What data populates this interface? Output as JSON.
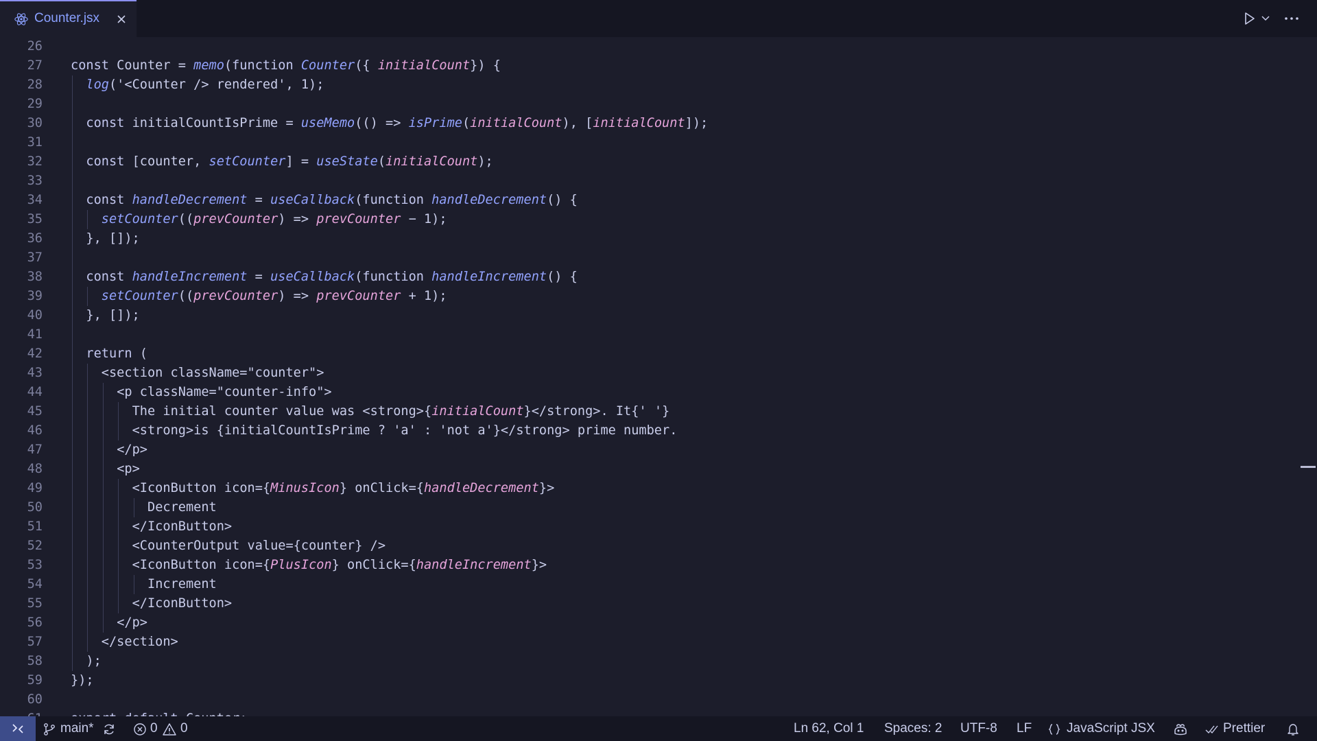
{
  "tab": {
    "label": "Counter.jsx",
    "icon": "react-icon"
  },
  "toolbar": {
    "run_icon": "play-icon",
    "run_menu_icon": "chevron-down-icon",
    "more_icon": "ellipsis-icon"
  },
  "editor": {
    "lines": [
      {
        "num": "26",
        "indent": 0,
        "guides": 0,
        "tokens": []
      },
      {
        "num": "27",
        "indent": 0,
        "guides": 0,
        "tokens": [
          [
            "kw",
            "const "
          ],
          [
            "",
            "Counter = "
          ],
          [
            "fn",
            "memo"
          ],
          [
            "",
            "("
          ],
          [
            "kw",
            "function "
          ],
          [
            "fn",
            "Counter"
          ],
          [
            "",
            "({ "
          ],
          [
            "prm",
            "initialCount"
          ],
          [
            "",
            ""
          ],
          [
            "",
            ""
          ],
          [
            "",
            "}) {"
          ]
        ]
      },
      {
        "num": "28",
        "indent": 1,
        "guides": 1,
        "tokens": [
          [
            "fn",
            "log"
          ],
          [
            "",
            "('<Counter /> rendered', 1);"
          ]
        ]
      },
      {
        "num": "29",
        "indent": 0,
        "guides": 1,
        "tokens": []
      },
      {
        "num": "30",
        "indent": 1,
        "guides": 1,
        "tokens": [
          [
            "kw",
            "const "
          ],
          [
            "",
            "initialCountIsPrime = "
          ],
          [
            "fn",
            "useMemo"
          ],
          [
            "",
            "(() => "
          ],
          [
            "fn",
            "isPrime"
          ],
          [
            "",
            "("
          ],
          [
            "prm",
            "initialCount"
          ],
          [
            "",
            "), ["
          ],
          [
            "prm",
            "initialCount"
          ],
          [
            "",
            "]);"
          ]
        ]
      },
      {
        "num": "31",
        "indent": 0,
        "guides": 1,
        "tokens": []
      },
      {
        "num": "32",
        "indent": 1,
        "guides": 1,
        "tokens": [
          [
            "kw",
            "const "
          ],
          [
            "",
            "[counter, "
          ],
          [
            "fn",
            "setCounter"
          ],
          [
            "",
            "] = "
          ],
          [
            "fn",
            "useState"
          ],
          [
            "",
            "("
          ],
          [
            "prm",
            "initialCount"
          ],
          [
            "",
            ");"
          ]
        ]
      },
      {
        "num": "33",
        "indent": 0,
        "guides": 1,
        "tokens": []
      },
      {
        "num": "34",
        "indent": 1,
        "guides": 1,
        "tokens": [
          [
            "kw",
            "const "
          ],
          [
            "fn",
            "handleDecrement"
          ],
          [
            "",
            " = "
          ],
          [
            "fn",
            "useCallback"
          ],
          [
            "",
            "("
          ],
          [
            "kw",
            "function "
          ],
          [
            "fn",
            "handleDecrement"
          ],
          [
            "",
            "() {"
          ]
        ]
      },
      {
        "num": "35",
        "indent": 2,
        "guides": 2,
        "tokens": [
          [
            "fn",
            "setCounter"
          ],
          [
            "",
            "(("
          ],
          [
            "prm",
            "prevCounter"
          ],
          [
            "",
            ") => "
          ],
          [
            "prm",
            "prevCounter"
          ],
          [
            "",
            " − 1);"
          ]
        ]
      },
      {
        "num": "36",
        "indent": 1,
        "guides": 1,
        "tokens": [
          [
            "",
            "}, []);"
          ]
        ]
      },
      {
        "num": "37",
        "indent": 0,
        "guides": 1,
        "tokens": []
      },
      {
        "num": "38",
        "indent": 1,
        "guides": 1,
        "tokens": [
          [
            "kw",
            "const "
          ],
          [
            "fn",
            "handleIncrement"
          ],
          [
            "",
            " = "
          ],
          [
            "fn",
            "useCallback"
          ],
          [
            "",
            "("
          ],
          [
            "kw",
            "function "
          ],
          [
            "fn",
            "handleIncrement"
          ],
          [
            "",
            "() {"
          ]
        ]
      },
      {
        "num": "39",
        "indent": 2,
        "guides": 2,
        "tokens": [
          [
            "fn",
            "setCounter"
          ],
          [
            "",
            "(("
          ],
          [
            "prm",
            "prevCounter"
          ],
          [
            "",
            ") => "
          ],
          [
            "prm",
            "prevCounter"
          ],
          [
            "",
            " + 1);"
          ]
        ]
      },
      {
        "num": "40",
        "indent": 1,
        "guides": 1,
        "tokens": [
          [
            "",
            "}, []);"
          ]
        ]
      },
      {
        "num": "41",
        "indent": 0,
        "guides": 1,
        "tokens": []
      },
      {
        "num": "42",
        "indent": 1,
        "guides": 1,
        "tokens": [
          [
            "kw",
            "return "
          ],
          [
            "",
            "("
          ]
        ]
      },
      {
        "num": "43",
        "indent": 2,
        "guides": 2,
        "tokens": [
          [
            "",
            "<section className=\"counter\">"
          ]
        ]
      },
      {
        "num": "44",
        "indent": 3,
        "guides": 3,
        "tokens": [
          [
            "",
            "<p className=\"counter-info\">"
          ]
        ]
      },
      {
        "num": "45",
        "indent": 4,
        "guides": 4,
        "tokens": [
          [
            "",
            "The initial counter value was <strong>{"
          ],
          [
            "prm",
            "initialCount"
          ],
          [
            "",
            "}</strong>. It{' '}"
          ]
        ]
      },
      {
        "num": "46",
        "indent": 4,
        "guides": 4,
        "tokens": [
          [
            "",
            "<strong>is {initialCountIsPrime ? 'a' : 'not a'}</strong> prime number."
          ]
        ]
      },
      {
        "num": "47",
        "indent": 3,
        "guides": 3,
        "tokens": [
          [
            "",
            "</p>"
          ]
        ]
      },
      {
        "num": "48",
        "indent": 3,
        "guides": 3,
        "tokens": [
          [
            "",
            "<p>"
          ]
        ]
      },
      {
        "num": "49",
        "indent": 4,
        "guides": 4,
        "tokens": [
          [
            "",
            "<IconButton icon={"
          ],
          [
            "prm",
            "MinusIcon"
          ],
          [
            "",
            "} onClick={"
          ],
          [
            "prm",
            "handleDecrement"
          ],
          [
            "",
            "}>"
          ]
        ]
      },
      {
        "num": "50",
        "indent": 5,
        "guides": 5,
        "tokens": [
          [
            "",
            "Decrement"
          ]
        ]
      },
      {
        "num": "51",
        "indent": 4,
        "guides": 4,
        "tokens": [
          [
            "",
            "</IconButton>"
          ]
        ]
      },
      {
        "num": "52",
        "indent": 4,
        "guides": 4,
        "tokens": [
          [
            "",
            "<CounterOutput value={counter} />"
          ]
        ]
      },
      {
        "num": "53",
        "indent": 4,
        "guides": 4,
        "tokens": [
          [
            "",
            "<IconButton icon={"
          ],
          [
            "prm",
            "PlusIcon"
          ],
          [
            "",
            "} onClick={"
          ],
          [
            "prm",
            "handleIncrement"
          ],
          [
            "",
            "}>"
          ]
        ]
      },
      {
        "num": "54",
        "indent": 5,
        "guides": 5,
        "tokens": [
          [
            "",
            "Increment"
          ]
        ]
      },
      {
        "num": "55",
        "indent": 4,
        "guides": 4,
        "tokens": [
          [
            "",
            "</IconButton>"
          ]
        ]
      },
      {
        "num": "56",
        "indent": 3,
        "guides": 3,
        "tokens": [
          [
            "",
            "</p>"
          ]
        ]
      },
      {
        "num": "57",
        "indent": 2,
        "guides": 2,
        "tokens": [
          [
            "",
            "</section>"
          ]
        ]
      },
      {
        "num": "58",
        "indent": 1,
        "guides": 1,
        "tokens": [
          [
            "",
            ");"
          ]
        ]
      },
      {
        "num": "59",
        "indent": 0,
        "guides": 0,
        "tokens": [
          [
            "",
            "});"
          ]
        ]
      },
      {
        "num": "60",
        "indent": 0,
        "guides": 0,
        "tokens": []
      },
      {
        "num": "61",
        "indent": 0,
        "guides": 0,
        "tokens": [
          [
            "kw",
            "export default "
          ],
          [
            "",
            "Counter;"
          ]
        ]
      }
    ]
  },
  "statusbar": {
    "remote_icon": "remote-icon",
    "branch": "main*",
    "errors": "0",
    "warnings": "0",
    "cursor": "Ln 62, Col 1",
    "spaces": "Spaces: 2",
    "encoding": "UTF-8",
    "eol": "LF",
    "language": "JavaScript JSX",
    "formatter": "Prettier"
  }
}
